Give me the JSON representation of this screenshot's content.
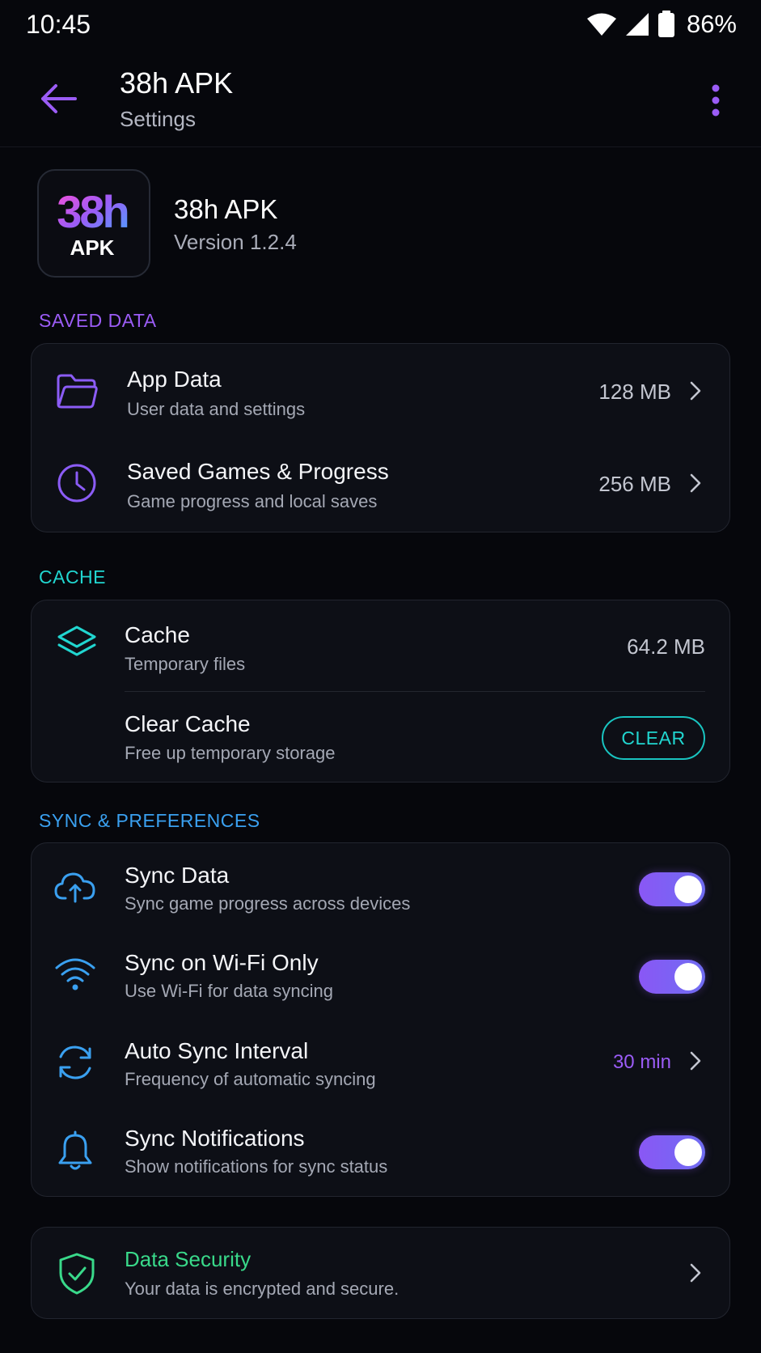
{
  "status": {
    "time": "10:45",
    "battery": "86%"
  },
  "header": {
    "title": "38h APK",
    "subtitle": "Settings"
  },
  "app": {
    "logo_top": "38h",
    "logo_bottom": "APK",
    "name": "38h APK",
    "version": "Version 1.2.4"
  },
  "sections": {
    "saved_data": "SAVED DATA",
    "cache": "CACHE",
    "sync": "SYNC & PREFERENCES"
  },
  "saved_data": [
    {
      "icon": "folder-icon",
      "title": "App Data",
      "subtitle": "User data and settings",
      "value": "128 MB"
    },
    {
      "icon": "clock-icon",
      "title": "Saved Games & Progress",
      "subtitle": "Game progress and local saves",
      "value": "256 MB"
    }
  ],
  "cache": {
    "row": {
      "icon": "layers-icon",
      "title": "Cache",
      "subtitle": "Temporary files",
      "value": "64.2 MB"
    },
    "clear": {
      "title": "Clear Cache",
      "subtitle": "Free up temporary storage",
      "button": "CLEAR"
    }
  },
  "sync": [
    {
      "icon": "cloud-sync-icon",
      "title": "Sync Data",
      "subtitle": "Sync game progress across devices",
      "toggle": true
    },
    {
      "icon": "wifi-icon",
      "title": "Sync on Wi-Fi Only",
      "subtitle": "Use Wi-Fi for data syncing",
      "toggle": true
    },
    {
      "icon": "refresh-icon",
      "title": "Auto Sync Interval",
      "subtitle": "Frequency of automatic syncing",
      "value": "30 min"
    },
    {
      "icon": "bell-icon",
      "title": "Sync Notifications",
      "subtitle": "Show notifications for sync status",
      "toggle": true
    }
  ],
  "security": {
    "icon": "shield-check-icon",
    "title": "Data Security",
    "subtitle": "Your data is encrypted and secure."
  },
  "colors": {
    "accent_purple": "#8a57f5",
    "accent_teal": "#21d6d0",
    "accent_blue": "#3aa0f0",
    "accent_green": "#39d98a",
    "background": "#06070c",
    "card": "#0d0f16"
  }
}
